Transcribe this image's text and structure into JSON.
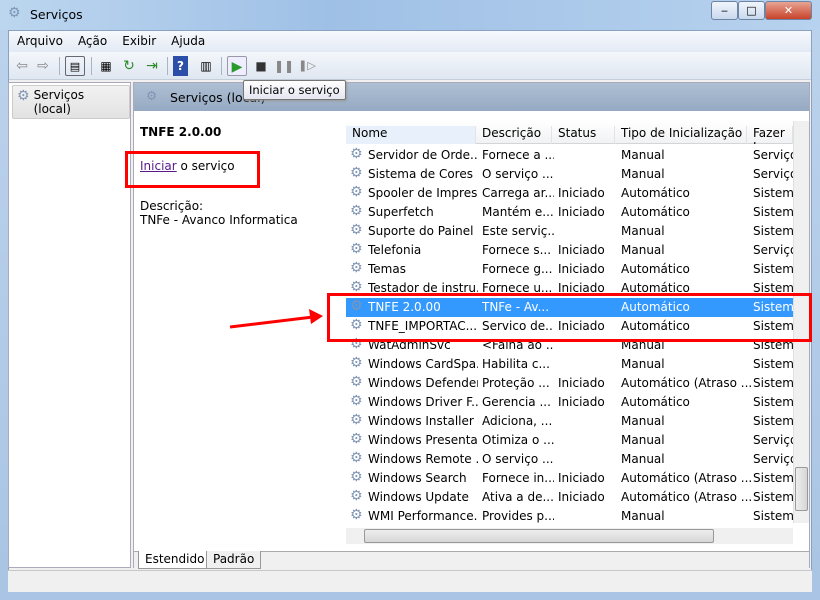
{
  "window": {
    "title": "Serviços",
    "minimize": "‒",
    "maximize": "□",
    "close": "✕"
  },
  "menu": [
    "Arquivo",
    "Ação",
    "Exibir",
    "Ajuda"
  ],
  "toolbar": {
    "tooltip": "Iniciar o serviço"
  },
  "tree": {
    "root": "Serviços (local)"
  },
  "pane": {
    "header": "Serviços (local)",
    "selected_name": "TNFE 2.0.00",
    "action_link": "Iniciar",
    "action_suffix": " o serviço",
    "description_label": "Descrição:",
    "description": "TNFe - Avanco Informatica"
  },
  "columns": [
    "Nome",
    "Descrição",
    "Status",
    "Tipo de Inicialização",
    "Fazer Lo"
  ],
  "rows": [
    [
      "Servidor de Orde...",
      "Fornece a ...",
      "",
      "Manual",
      "Serviço"
    ],
    [
      "Sistema de Cores ...",
      "O serviço ...",
      "",
      "Manual",
      "Serviço"
    ],
    [
      "Spooler de Impres...",
      "Carrega ar...",
      "Iniciado",
      "Automático",
      "Sistema"
    ],
    [
      "Superfetch",
      "Mantém e...",
      "Iniciado",
      "Automático",
      "Sistema"
    ],
    [
      "Suporte do Painel ...",
      "Este serviç...",
      "",
      "Manual",
      "Sistema"
    ],
    [
      "Telefonia",
      "Fornece s...",
      "Iniciado",
      "Manual",
      "Serviço"
    ],
    [
      "Temas",
      "Fornece g...",
      "Iniciado",
      "Automático",
      "Sistema"
    ],
    [
      "Testador de instru...",
      "Fornece u...",
      "Iniciado",
      "Automático",
      "Sistema"
    ],
    [
      "TNFE 2.0.00",
      "TNFe - Av...",
      "",
      "Automático",
      "Sistema"
    ],
    [
      "TNFE_IMPORTAC...",
      "Servico de...",
      "Iniciado",
      "Automático",
      "Sistema"
    ],
    [
      "WatAdminSvc",
      "<Falha ao ...",
      "",
      "Manual",
      "Sistema"
    ],
    [
      "Windows CardSpa...",
      "Habilita c...",
      "",
      "Manual",
      "Sistema"
    ],
    [
      "Windows Defender",
      "Proteção ...",
      "Iniciado",
      "Automático (Atraso ...",
      "Sistema"
    ],
    [
      "Windows Driver F...",
      "Gerencia ...",
      "Iniciado",
      "Automático",
      "Sistema"
    ],
    [
      "Windows Installer",
      "Adiciona, ...",
      "",
      "Manual",
      "Sistema"
    ],
    [
      "Windows Presenta...",
      "Otimiza o ...",
      "",
      "Manual",
      "Serviço"
    ],
    [
      "Windows Remote ...",
      "O serviço ...",
      "",
      "Manual",
      "Serviço"
    ],
    [
      "Windows Search",
      "Fornece in...",
      "Iniciado",
      "Automático (Atraso ...",
      "Sistema"
    ],
    [
      "Windows Update",
      "Ativa a de...",
      "Iniciado",
      "Automático (Atraso ...",
      "Sistema"
    ],
    [
      "WMI Performance...",
      "Provides p...",
      "",
      "Manual",
      "Sistema"
    ]
  ],
  "selected_row": 8,
  "tabs": [
    "Estendido",
    "Padrão"
  ],
  "colors": {
    "selection": "#3399ff",
    "annotation": "#ff0000"
  }
}
